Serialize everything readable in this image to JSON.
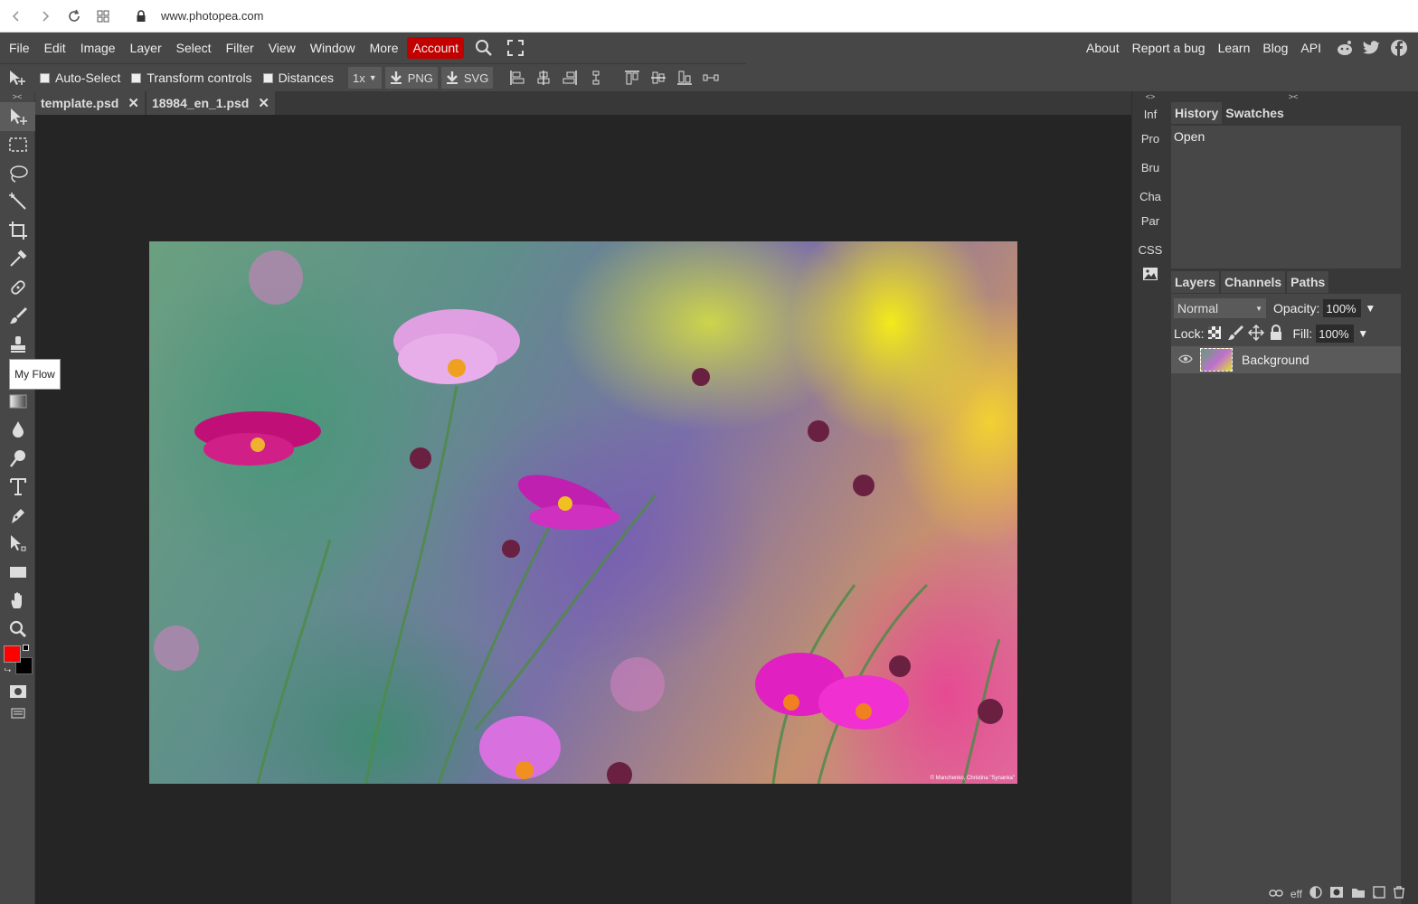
{
  "browser": {
    "url": "www.photopea.com",
    "icons": [
      "back-icon",
      "forward-icon",
      "reload-icon",
      "apps-icon",
      "lock-icon"
    ]
  },
  "menu": {
    "items": [
      "File",
      "Edit",
      "Image",
      "Layer",
      "Select",
      "Filter",
      "View",
      "Window",
      "More"
    ],
    "account": "Account",
    "right_items": [
      "About",
      "Report a bug",
      "Learn",
      "Blog",
      "API"
    ],
    "accent_color": "#c20000"
  },
  "options": {
    "auto_select": "Auto-Select",
    "transform_controls": "Transform controls",
    "distances": "Distances",
    "scale": "1x",
    "png": "PNG",
    "svg": "SVG"
  },
  "tabs": [
    {
      "label": "template.psd"
    },
    {
      "label": "18984_en_1.psd"
    }
  ],
  "tooltip": "My Flow",
  "artwork": {
    "copyright": "© Manchenko, Christina \"Synanka\""
  },
  "right_strip": {
    "items": [
      "Inf",
      "Pro",
      "Bru",
      "Cha",
      "Par",
      "CSS"
    ]
  },
  "history": {
    "tabs": [
      "History",
      "Swatches"
    ],
    "entries": [
      "Open"
    ]
  },
  "layers": {
    "tabs": [
      "Layers",
      "Channels",
      "Paths"
    ],
    "blend_mode": "Normal",
    "opacity_label": "Opacity:",
    "opacity": "100%",
    "lock_label": "Lock:",
    "fill_label": "Fill:",
    "fill": "100%",
    "items": [
      {
        "name": "Background"
      }
    ],
    "bottom_eff": "eff"
  },
  "colors": {
    "foreground": "#ff0000",
    "background": "#000000"
  }
}
